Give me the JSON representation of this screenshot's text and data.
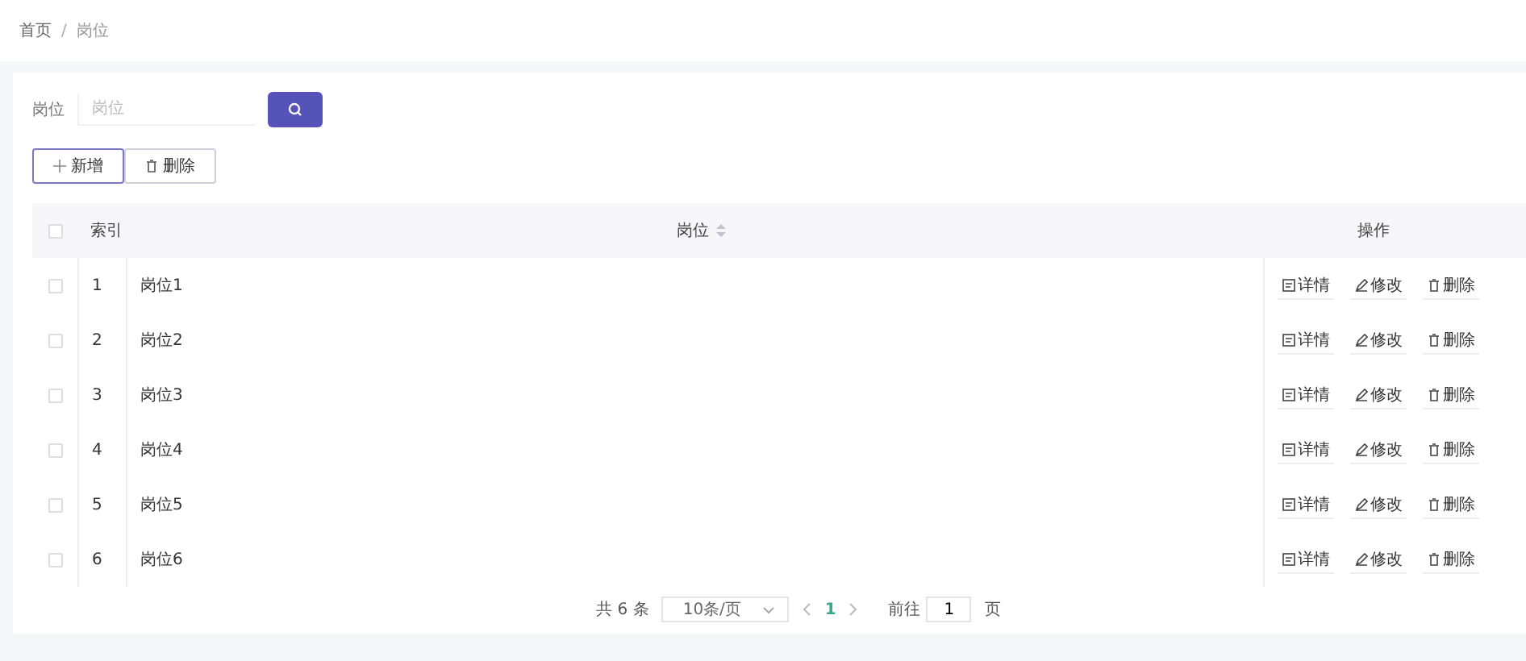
{
  "breadcrumb": [
    {
      "label": "首页",
      "selected": false
    },
    {
      "label": "岗位",
      "selected": true
    }
  ],
  "breadcrumb_separator": "/",
  "search": {
    "label": "岗位",
    "placeholder": "岗位"
  },
  "toolbar": [
    {
      "kind": "add",
      "label": "新增"
    },
    {
      "kind": "delete",
      "label": "删除"
    }
  ],
  "table": {
    "header_checked": false,
    "columns": [
      "索引",
      "岗位",
      "操作"
    ],
    "rows": [
      {
        "index": "1",
        "name": "岗位1",
        "checked": false,
        "actions": [
          {
            "kind": "detail",
            "label": "详情"
          },
          {
            "kind": "edit",
            "label": "修改"
          },
          {
            "kind": "delete",
            "label": "删除"
          }
        ]
      },
      {
        "index": "2",
        "name": "岗位2",
        "checked": false,
        "actions": [
          {
            "kind": "detail",
            "label": "详情"
          },
          {
            "kind": "edit",
            "label": "修改"
          },
          {
            "kind": "delete",
            "label": "删除"
          }
        ]
      },
      {
        "index": "3",
        "name": "岗位3",
        "checked": false,
        "actions": [
          {
            "kind": "detail",
            "label": "详情"
          },
          {
            "kind": "edit",
            "label": "修改"
          },
          {
            "kind": "delete",
            "label": "删除"
          }
        ]
      },
      {
        "index": "4",
        "name": "岗位4",
        "checked": false,
        "actions": [
          {
            "kind": "detail",
            "label": "详情"
          },
          {
            "kind": "edit",
            "label": "修改"
          },
          {
            "kind": "delete",
            "label": "删除"
          }
        ]
      },
      {
        "index": "5",
        "name": "岗位5",
        "checked": false,
        "actions": [
          {
            "kind": "detail",
            "label": "详情"
          },
          {
            "kind": "edit",
            "label": "修改"
          },
          {
            "kind": "delete",
            "label": "删除"
          }
        ]
      },
      {
        "index": "6",
        "name": "岗位6",
        "checked": false,
        "actions": [
          {
            "kind": "detail",
            "label": "详情"
          },
          {
            "kind": "edit",
            "label": "修改"
          },
          {
            "kind": "delete",
            "label": "删除"
          }
        ]
      }
    ]
  },
  "pagination": {
    "total": "共 6 条",
    "page_size": "10条/页",
    "pages": [
      {
        "label": "1",
        "selected": true
      }
    ],
    "goto_label": "前往",
    "goto_value": "1",
    "goto_suffix": "页"
  }
}
